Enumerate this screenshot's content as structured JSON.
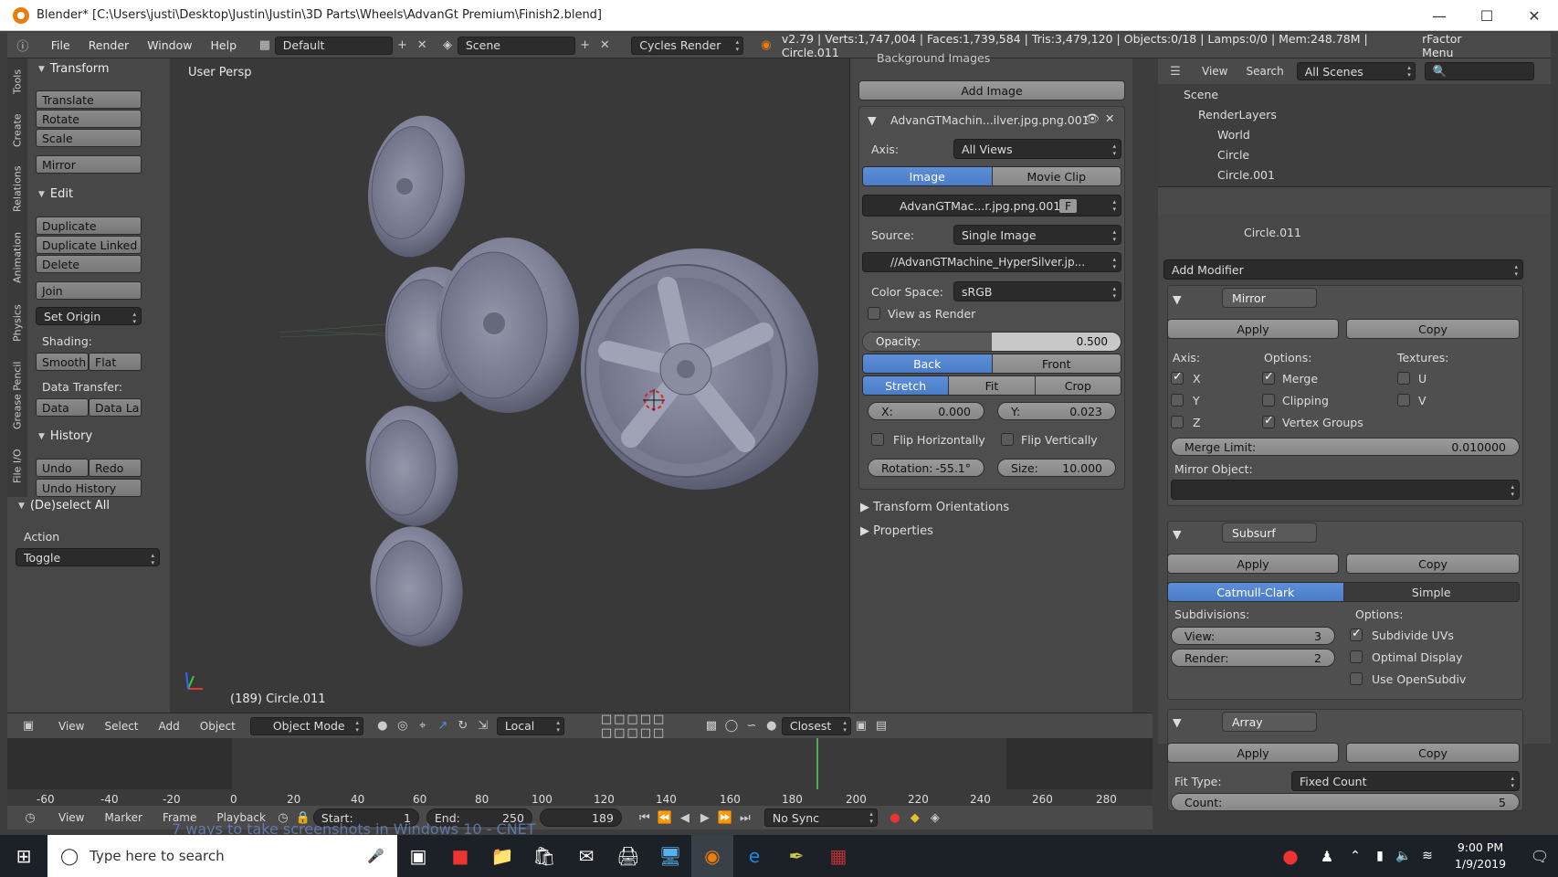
{
  "window": {
    "title": "Blender* [C:\\Users\\justi\\Desktop\\Justin\\Justin\\3D Parts\\Wheels\\AdvanGt Premium\\Finish2.blend]",
    "min": "—",
    "max": "☐",
    "close": "✕"
  },
  "menubar": {
    "items": [
      "File",
      "Render",
      "Window",
      "Help"
    ],
    "layout": "Default",
    "scene": "Scene",
    "engine": "Cycles Render",
    "stats": "v2.79 | Verts:1,747,004 | Faces:1,739,584 | Tris:3,479,120 | Objects:0/18 | Lamps:0/0 | Mem:248.78M | Circle.011",
    "right_menu": "rFactor Menu"
  },
  "tools": {
    "tabs": [
      "Tools",
      "Create",
      "Relations",
      "Animation",
      "Physics",
      "Grease Pencil",
      "File I/O"
    ],
    "transform": {
      "title": "Transform",
      "buttons": [
        "Translate",
        "Rotate",
        "Scale",
        "Mirror"
      ]
    },
    "edit": {
      "title": "Edit",
      "buttons": [
        "Duplicate",
        "Duplicate Linked",
        "Delete",
        "Join"
      ],
      "set_origin": "Set Origin",
      "shading_label": "Shading:",
      "smooth": "Smooth",
      "flat": "Flat",
      "data_transfer_label": "Data Transfer:",
      "data": "Data",
      "data_la": "Data La"
    },
    "history": {
      "title": "History",
      "undo": "Undo",
      "redo": "Redo",
      "undo_history": "Undo History"
    },
    "deselect": {
      "title": "(De)select All",
      "action_label": "Action",
      "action_value": "Toggle"
    }
  },
  "viewport": {
    "persp": "User Persp",
    "object_label": "(189) Circle.011"
  },
  "bg_images": {
    "header": "Background Images",
    "add_image": "Add Image",
    "item_name": "AdvanGTMachin...ilver.jpg.png.001",
    "axis_label": "Axis:",
    "axis_value": "All Views",
    "tab_image": "Image",
    "tab_movie": "Movie Clip",
    "image_name": "AdvanGTMac...r.jpg.png.001",
    "image_f": "F",
    "source_label": "Source:",
    "source_value": "Single Image",
    "filepath": "//AdvanGTMachine_HyperSilver.jp...",
    "colorspace_label": "Color Space:",
    "colorspace_value": "sRGB",
    "view_as_render": "View as Render",
    "opacity_label": "Opacity:",
    "opacity_value": "0.500",
    "opacity_fraction": 0.5,
    "back": "Back",
    "front": "Front",
    "stretch": "Stretch",
    "fit": "Fit",
    "crop": "Crop",
    "x_label": "X:",
    "x_value": "0.000",
    "y_label": "Y:",
    "y_value": "0.023",
    "flip_h": "Flip Horizontally",
    "flip_v": "Flip Vertically",
    "rotation_label": "Rotation:",
    "rotation_value": "-55.1°",
    "size_label": "Size:",
    "size_value": "10.000",
    "transform_orient": "Transform Orientations",
    "properties": "Properties"
  },
  "outliner": {
    "view": "View",
    "search": "Search",
    "filter": "All Scenes",
    "items": [
      "Scene",
      "RenderLayers",
      "World",
      "Circle",
      "Circle.001"
    ]
  },
  "properties": {
    "object": "Circle.011",
    "add_modifier": "Add Modifier",
    "mirror": {
      "name": "Mirror",
      "apply": "Apply",
      "copy": "Copy",
      "axis_label": "Axis:",
      "options_label": "Options:",
      "textures_label": "Textures:",
      "x": "X",
      "y": "Y",
      "z": "Z",
      "merge": "Merge",
      "clipping": "Clipping",
      "vertex_groups": "Vertex Groups",
      "u": "U",
      "v": "V",
      "merge_limit_label": "Merge Limit:",
      "merge_limit_value": "0.010000",
      "mirror_object_label": "Mirror Object:"
    },
    "subsurf": {
      "name": "Subsurf",
      "apply": "Apply",
      "copy": "Copy",
      "catmull": "Catmull-Clark",
      "simple": "Simple",
      "subdivisions_label": "Subdivisions:",
      "options_label": "Options:",
      "view_label": "View:",
      "view_value": "3",
      "render_label": "Render:",
      "render_value": "2",
      "subdivide_uvs": "Subdivide UVs",
      "optimal_display": "Optimal Display",
      "use_opensubdiv": "Use OpenSubdiv"
    },
    "array": {
      "name": "Array",
      "apply": "Apply",
      "copy": "Copy",
      "fit_type_label": "Fit Type:",
      "fit_type_value": "Fixed Count",
      "count_label": "Count:",
      "count_value": "5"
    }
  },
  "view3d_header": {
    "view": "View",
    "select": "Select",
    "add": "Add",
    "object": "Object",
    "mode": "Object Mode",
    "pivot": "Local",
    "snap": "Closest"
  },
  "timeline": {
    "ticks": [
      "-60",
      "-40",
      "-20",
      "0",
      "20",
      "40",
      "60",
      "80",
      "100",
      "120",
      "140",
      "160",
      "180",
      "200",
      "220",
      "240",
      "260",
      "280"
    ],
    "view": "View",
    "marker": "Marker",
    "frame": "Frame",
    "playback": "Playback",
    "start_label": "Start:",
    "start_value": "1",
    "end_label": "End:",
    "end_value": "250",
    "current": "189",
    "sync": "No Sync",
    "overlay_text": "7 ways to take screenshots in Windows 10 - CNET"
  },
  "taskbar": {
    "search_placeholder": "Type here to search",
    "time": "9:00 PM",
    "date": "1/9/2019"
  }
}
